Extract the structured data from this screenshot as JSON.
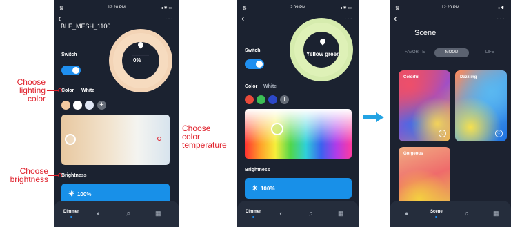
{
  "status": {
    "time_1": "12:20 PM",
    "time_2": "2:09 PM",
    "time_3": "12:20 PM",
    "wifi_icon": "wifi-icon",
    "battery_icon": "battery-icon"
  },
  "phone1": {
    "device_title": "BLE_MESH_1100...",
    "percent": "0%",
    "switch_label": "Switch",
    "color_tab": "Color",
    "white_tab": "White",
    "brightness_label": "Brightness",
    "brightness_value": "100%",
    "swatches": [
      "#f2c9a0",
      "#ffffff",
      "#dfe6f4"
    ]
  },
  "phone2": {
    "color_name": "Yellow green",
    "switch_label": "Switch",
    "color_tab": "Color",
    "white_tab": "White",
    "brightness_label": "Brightness",
    "brightness_value": "100%",
    "swatches": [
      "#e84a3a",
      "#3bbf55",
      "#2c48c8"
    ]
  },
  "phone3": {
    "title": "Scene",
    "tabs": [
      "FAVORITE",
      "MOOD",
      "LIFE"
    ],
    "active_tab": "MOOD",
    "cards": [
      "Colorful",
      "Dazzling",
      "Gorgeous"
    ]
  },
  "tabbar": {
    "dimmer": "Dimmer",
    "scene": "Scene"
  },
  "annotations": {
    "lighting": [
      "Choose",
      "lighting",
      "color"
    ],
    "temperature": [
      "Choose",
      "color",
      "temperature"
    ],
    "brightness": [
      "Choose",
      "brightness"
    ]
  },
  "colors": {
    "accent": "#1f8ff0",
    "background": "#1b2230",
    "annotation": "#e0202b"
  }
}
